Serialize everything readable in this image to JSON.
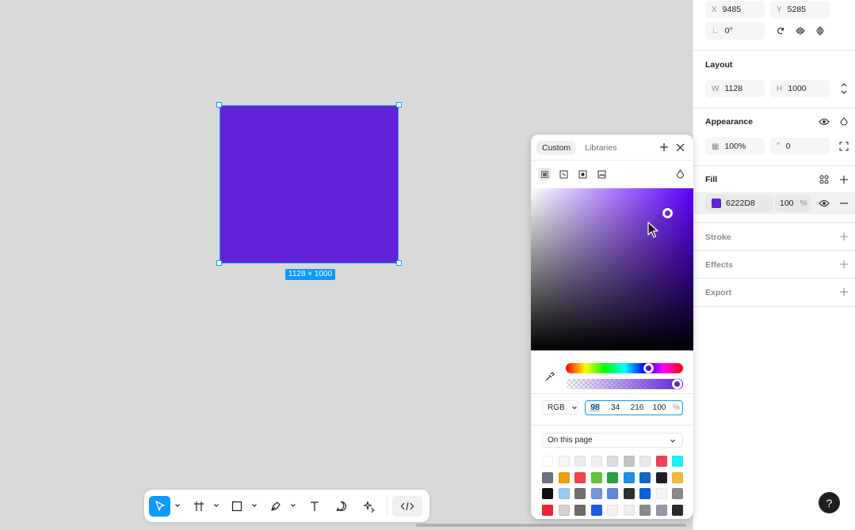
{
  "panel": {
    "position": {
      "x_label": "X",
      "x_value": "9485",
      "y_label": "Y",
      "y_value": "5285"
    },
    "rotation": {
      "value": "0°"
    },
    "layout": {
      "title": "Layout",
      "w_label": "W",
      "w_value": "1128",
      "h_label": "H",
      "h_value": "1000"
    },
    "appearance": {
      "title": "Appearance",
      "opacity": "100%",
      "radius": "0"
    },
    "fill": {
      "title": "Fill",
      "hex": "6222D8",
      "opacity": "100",
      "percent": "%",
      "color": "#6222d8"
    },
    "stroke": {
      "title": "Stroke"
    },
    "effects": {
      "title": "Effects"
    },
    "export": {
      "title": "Export"
    }
  },
  "canvas": {
    "frame_color": "#6222d8",
    "dimension_label": "1128 × 1000"
  },
  "picker": {
    "tabs": [
      {
        "label": "Custom",
        "active": true
      },
      {
        "label": "Libraries",
        "active": false
      }
    ],
    "mode": "RGB",
    "r": "98",
    "g": "34",
    "b": "216",
    "a": "100",
    "percent": "%",
    "library_select": "On this page",
    "swatches": [
      "#ffffff",
      "#f5f5f5",
      "#ebebeb",
      "#f0f0f0",
      "#dcdcdc",
      "#c4c4c4",
      "#e8e8e8",
      "#f24058",
      "#19f2f2",
      "#6b7280",
      "#f59e0b",
      "#ef4444",
      "#65c23f",
      "#2e9e46",
      "#1a8fe3",
      "#1565c0",
      "#1e1e2a",
      "#f4b942",
      "#111111",
      "#9cc8f2",
      "#707070",
      "#7c93d6",
      "#5f85e0",
      "#2f2f2f",
      "#0b5ed7",
      "#f5f5f5",
      "#8a8a8a",
      "#ee2433",
      "#d0d0d0",
      "#6b6b6b",
      "#1e5be6",
      "#f2f2f2",
      "#eeeeee",
      "#8a8a8a",
      "#9497a8",
      "#2a2a2a"
    ]
  },
  "help": {
    "label": "?"
  }
}
